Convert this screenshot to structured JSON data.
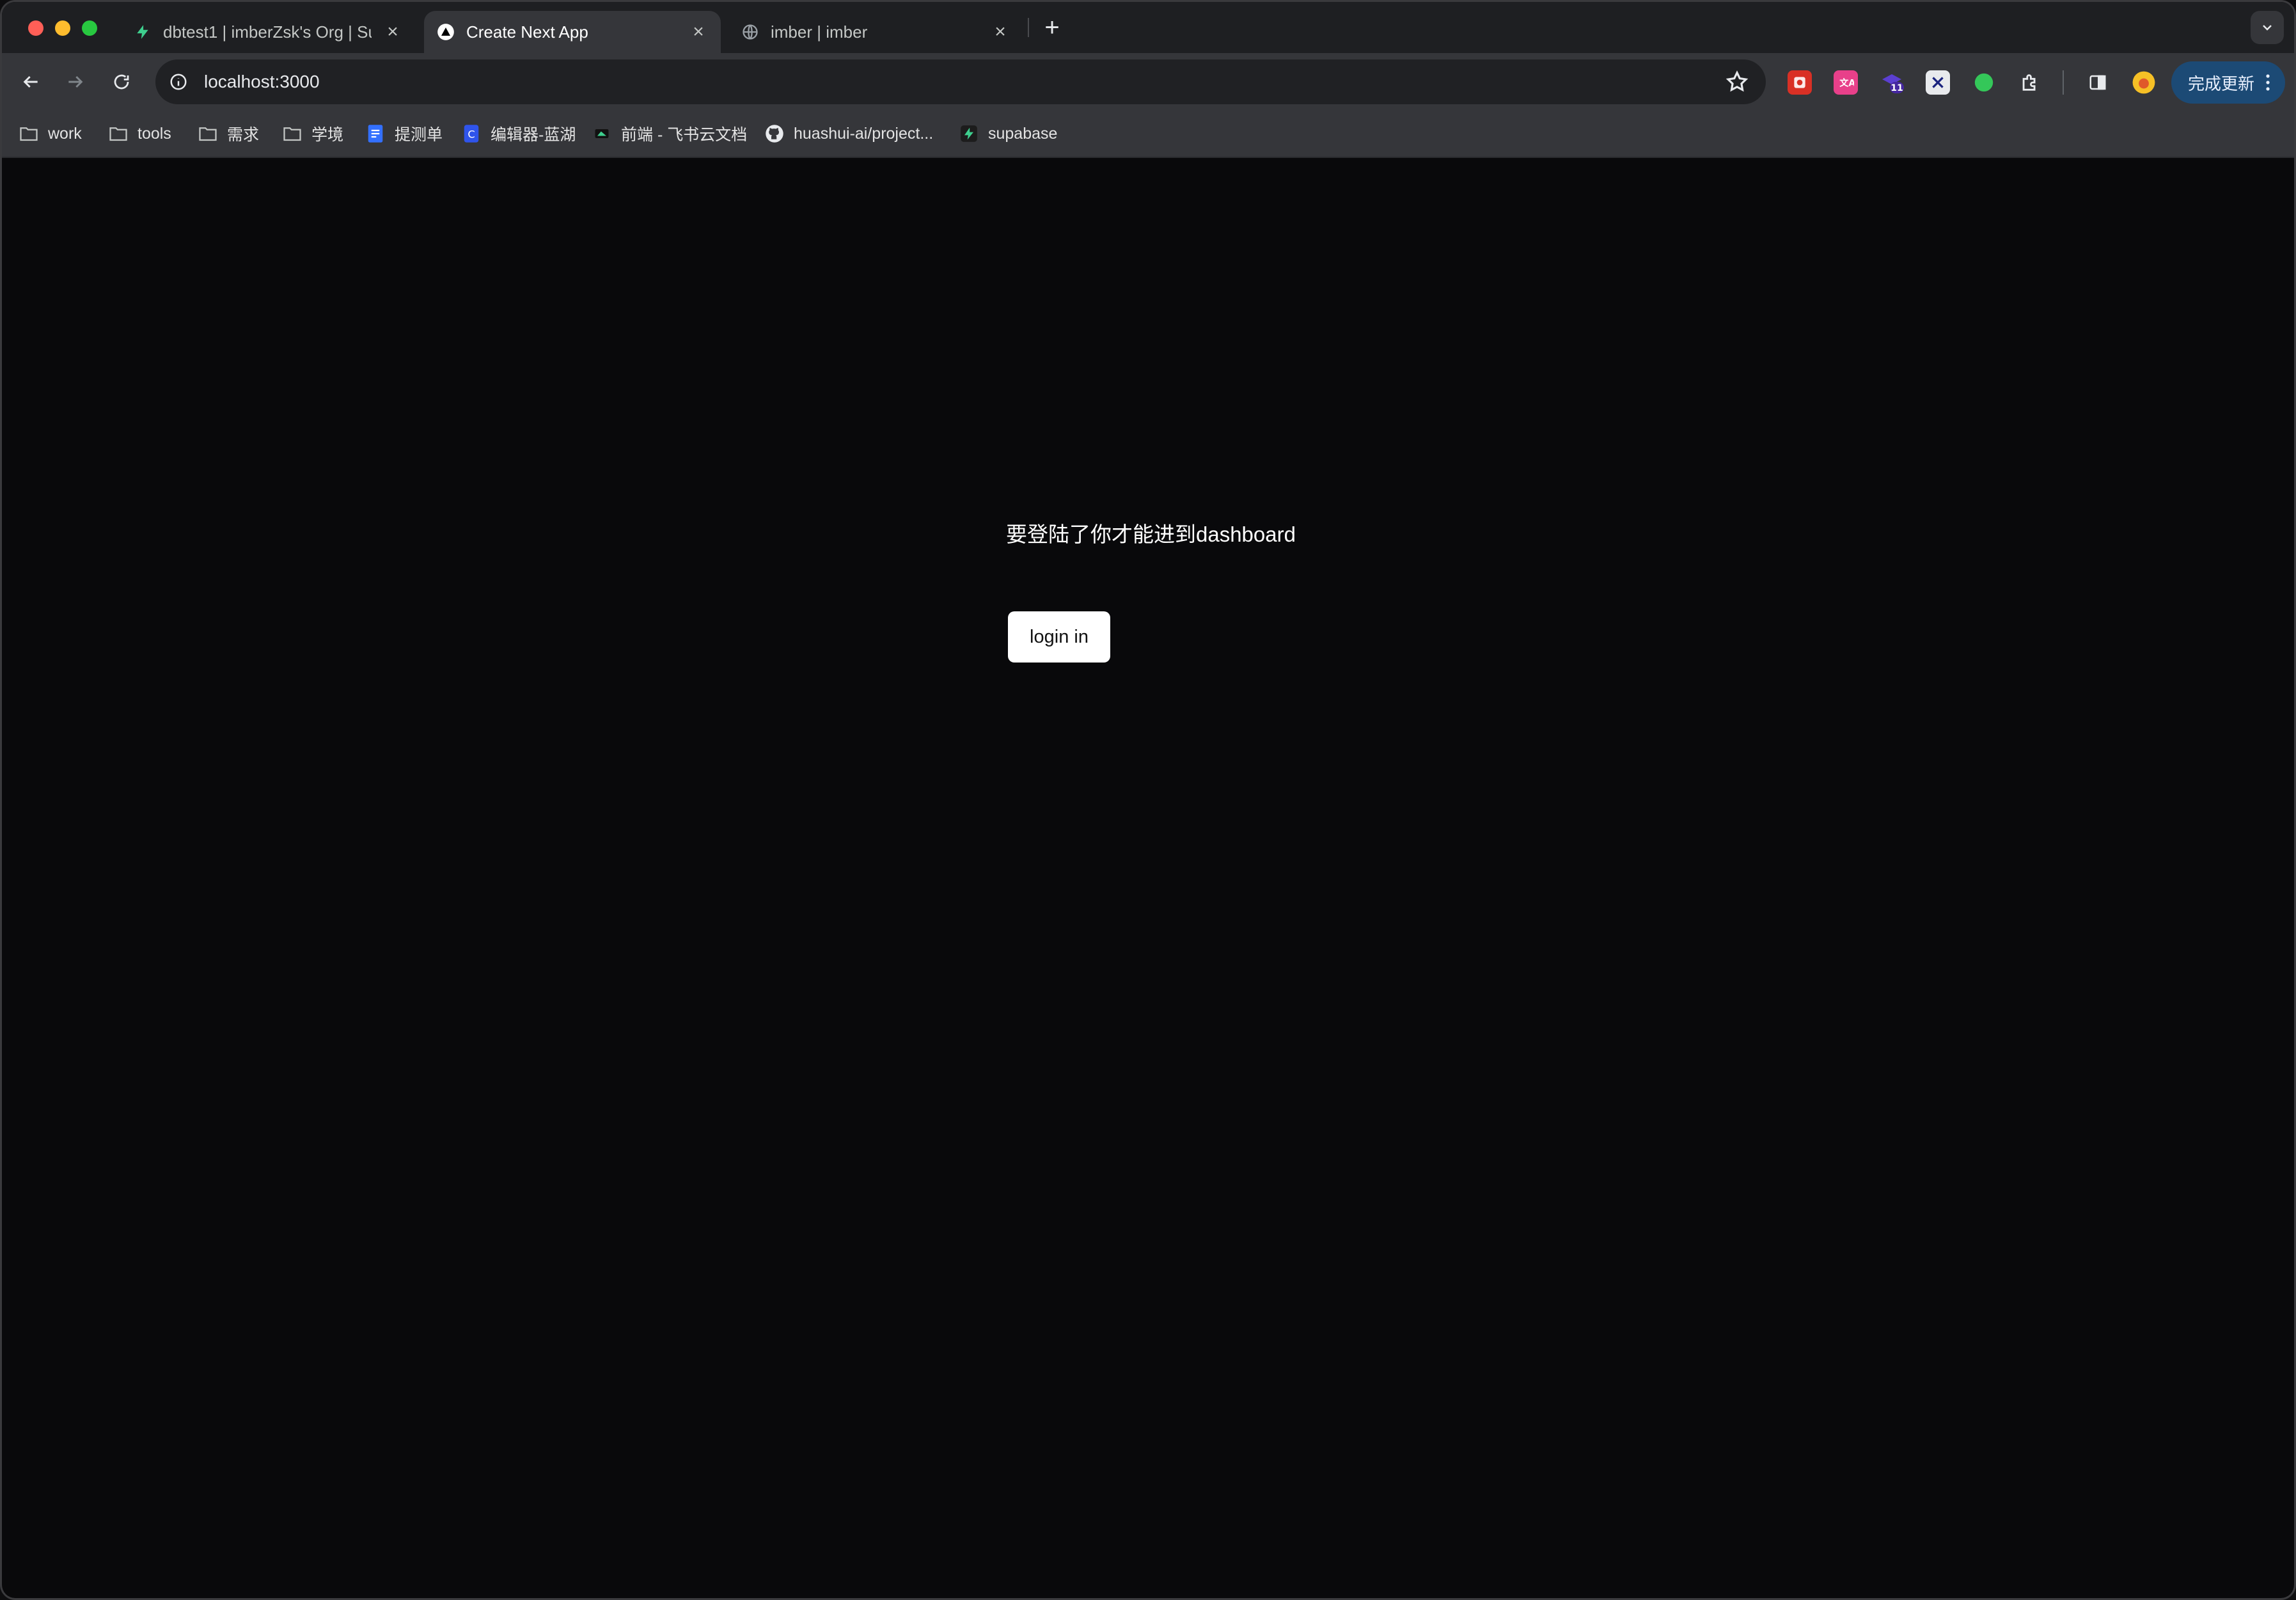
{
  "browser": {
    "tabs": [
      {
        "title": "dbtest1 | imberZsk's Org | Supabase",
        "active": false
      },
      {
        "title": "Create Next App",
        "active": true
      },
      {
        "title": "imber | imber",
        "active": false
      }
    ],
    "new_tab_label": "+",
    "close_glyph": "×",
    "address_bar": {
      "url": "localhost:3000"
    },
    "update_button_label": "完成更新",
    "extension_badge": "11",
    "bookmarks": [
      {
        "label": "work",
        "icon": "folder-icon"
      },
      {
        "label": "tools",
        "icon": "folder-icon"
      },
      {
        "label": "需求",
        "icon": "folder-icon"
      },
      {
        "label": "学境",
        "icon": "folder-icon"
      },
      {
        "label": "提测单",
        "icon": "doc-icon"
      },
      {
        "label": "编辑器-蓝湖",
        "icon": "lanhu-icon"
      },
      {
        "label": "前端 - 飞书云文档",
        "icon": "feishu-icon"
      },
      {
        "label": "huashui-ai/project...",
        "icon": "github-icon"
      },
      {
        "label": "supabase",
        "icon": "supabase-icon"
      }
    ]
  },
  "page": {
    "message": "要登陆了你才能进到dashboard",
    "login_button": "login in"
  },
  "colors": {
    "page_background": "#09090b",
    "button_background": "#ffffff",
    "update_button": "#1c4a75",
    "supabase_green": "#3ecf8e"
  }
}
